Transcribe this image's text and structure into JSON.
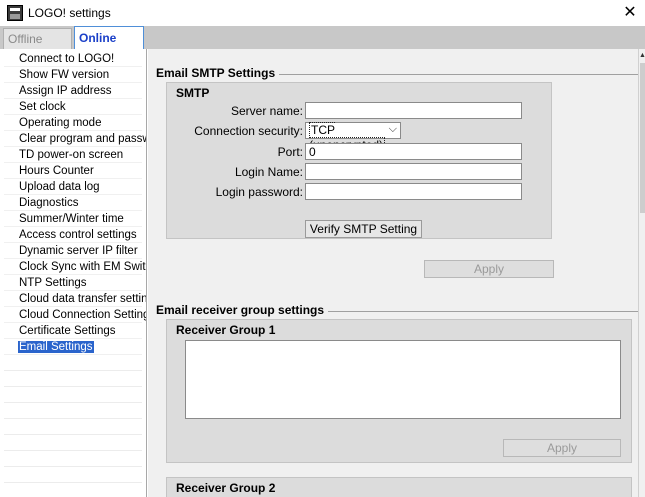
{
  "window": {
    "title": "LOGO! settings",
    "close_glyph": "✕"
  },
  "tabs": [
    {
      "label": "Offline settings",
      "active": false
    },
    {
      "label": "Online settings",
      "active": true
    }
  ],
  "nav": {
    "items": [
      {
        "label": "Connect to LOGO!"
      },
      {
        "label": "Show FW version"
      },
      {
        "label": "Assign IP address"
      },
      {
        "label": "Set clock"
      },
      {
        "label": "Operating mode"
      },
      {
        "label": "Clear program and password"
      },
      {
        "label": "TD power-on screen"
      },
      {
        "label": "Hours Counter"
      },
      {
        "label": "Upload data log"
      },
      {
        "label": "Diagnostics"
      },
      {
        "label": "Summer/Winter time"
      },
      {
        "label": "Access control settings"
      },
      {
        "label": "Dynamic server IP filter"
      },
      {
        "label": "Clock Sync with EM Switch"
      },
      {
        "label": "NTP Settings"
      },
      {
        "label": "Cloud data transfer settings"
      },
      {
        "label": "Cloud Connection Settings"
      },
      {
        "label": "Certificate Settings"
      },
      {
        "label": "Email Settings",
        "selected": true
      }
    ]
  },
  "smtp_section": {
    "title": "Email SMTP Settings",
    "group_title": "SMTP",
    "server_name_label": "Server name:",
    "server_name_value": "",
    "security_label": "Connection security:",
    "security_value": "TCP (unencrypted)",
    "port_label": "Port:",
    "port_value": "0",
    "login_name_label": "Login Name:",
    "login_name_value": "",
    "login_password_label": "Login password:",
    "login_password_value": "",
    "verify_button": "Verify SMTP Setting",
    "apply_button": "Apply"
  },
  "receiver_section": {
    "title": "Email receiver group settings",
    "group1_title": "Receiver Group 1",
    "group1_apply": "Apply",
    "group2_title": "Receiver Group 2"
  }
}
